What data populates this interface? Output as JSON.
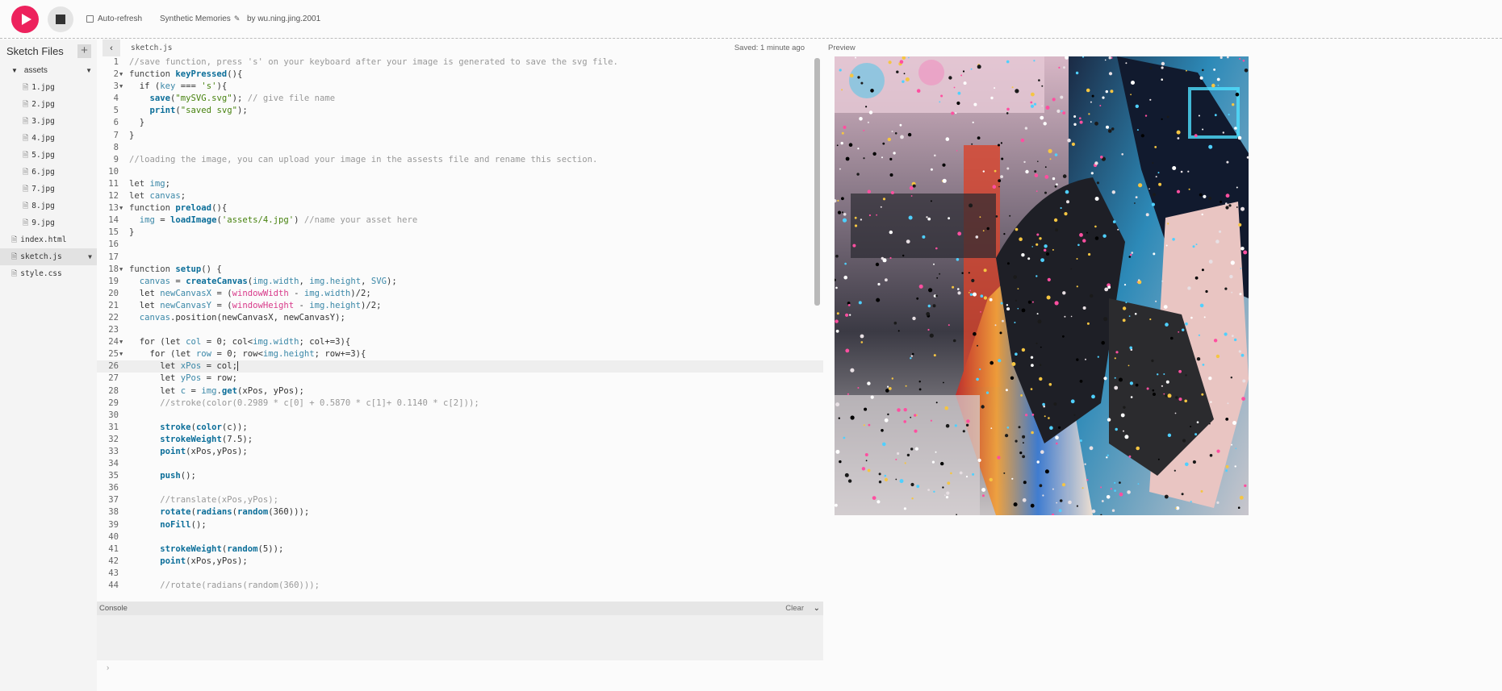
{
  "toolbar": {
    "autorefresh_label": "Auto-refresh",
    "project_name": "Synthetic Memories",
    "byline": "by wu.ning.jing.2001"
  },
  "sidebar": {
    "title": "Sketch Files",
    "folder": "assets",
    "asset_files": [
      "1.jpg",
      "2.jpg",
      "3.jpg",
      "4.jpg",
      "5.jpg",
      "6.jpg",
      "7.jpg",
      "8.jpg",
      "9.jpg"
    ],
    "root_files": [
      "index.html",
      "sketch.js",
      "style.css"
    ],
    "active_file": "sketch.js"
  },
  "editor": {
    "filename": "sketch.js",
    "saved_status": "Saved: 1 minute ago",
    "cursor_line": 26
  },
  "preview": {
    "label": "Preview"
  },
  "console": {
    "title": "Console",
    "clear_label": "Clear",
    "prompt": "›"
  },
  "code_lines": [
    [
      [
        "c",
        "//save function, press 's' on your keyboard after your image is generated to save the svg file."
      ]
    ],
    [
      [
        "k",
        "function "
      ],
      [
        "f",
        "keyPressed"
      ],
      [
        "n",
        "(){"
      ]
    ],
    [
      [
        "n",
        "  if ("
      ],
      [
        "v",
        "key"
      ],
      [
        "n",
        " === "
      ],
      [
        "s",
        "'s'"
      ],
      [
        "n",
        "){"
      ]
    ],
    [
      [
        "n",
        "    "
      ],
      [
        "f",
        "save"
      ],
      [
        "n",
        "("
      ],
      [
        "s",
        "\"mySVG.svg\""
      ],
      [
        "n",
        "); "
      ],
      [
        "c",
        "// give file name"
      ]
    ],
    [
      [
        "n",
        "    "
      ],
      [
        "f",
        "print"
      ],
      [
        "n",
        "("
      ],
      [
        "s",
        "\"saved svg\""
      ],
      [
        "n",
        ");"
      ]
    ],
    [
      [
        "n",
        "  }"
      ]
    ],
    [
      [
        "n",
        "}"
      ]
    ],
    [],
    [
      [
        "c",
        "//loading the image, you can upload your image in the assests file and rename this section."
      ]
    ],
    [],
    [
      [
        "k",
        "let "
      ],
      [
        "v",
        "img"
      ],
      [
        "n",
        ";"
      ]
    ],
    [
      [
        "k",
        "let "
      ],
      [
        "v",
        "canvas"
      ],
      [
        "n",
        ";"
      ]
    ],
    [
      [
        "k",
        "function "
      ],
      [
        "f",
        "preload"
      ],
      [
        "n",
        "(){"
      ]
    ],
    [
      [
        "n",
        "  "
      ],
      [
        "v",
        "img"
      ],
      [
        "n",
        " = "
      ],
      [
        "f",
        "loadImage"
      ],
      [
        "n",
        "("
      ],
      [
        "s",
        "'assets/4.jpg'"
      ],
      [
        "n",
        ") "
      ],
      [
        "c",
        "//name your asset here"
      ]
    ],
    [
      [
        "n",
        "}"
      ]
    ],
    [],
    [],
    [
      [
        "k",
        "function "
      ],
      [
        "f",
        "setup"
      ],
      [
        "n",
        "() {"
      ]
    ],
    [
      [
        "n",
        "  "
      ],
      [
        "v",
        "canvas"
      ],
      [
        "n",
        " = "
      ],
      [
        "f",
        "createCanvas"
      ],
      [
        "n",
        "("
      ],
      [
        "v",
        "img.width"
      ],
      [
        "n",
        ", "
      ],
      [
        "v",
        "img.height"
      ],
      [
        "n",
        ", "
      ],
      [
        "v",
        "SVG"
      ],
      [
        "n",
        ");"
      ]
    ],
    [
      [
        "n",
        "  let "
      ],
      [
        "v",
        "newCanvasX"
      ],
      [
        "n",
        " = ("
      ],
      [
        "m",
        "windowWidth"
      ],
      [
        "n",
        " - "
      ],
      [
        "v",
        "img.width"
      ],
      [
        "n",
        ")/2;"
      ]
    ],
    [
      [
        "n",
        "  let "
      ],
      [
        "v",
        "newCanvasY"
      ],
      [
        "n",
        " = ("
      ],
      [
        "m",
        "windowHeight"
      ],
      [
        "n",
        " - "
      ],
      [
        "v",
        "img.height"
      ],
      [
        "n",
        ")/2;"
      ]
    ],
    [
      [
        "n",
        "  "
      ],
      [
        "v",
        "canvas"
      ],
      [
        "n",
        ".position(newCanvasX, newCanvasY);"
      ]
    ],
    [],
    [
      [
        "n",
        "  for (let "
      ],
      [
        "v",
        "col"
      ],
      [
        "n",
        " = 0; col<"
      ],
      [
        "v",
        "img.width"
      ],
      [
        "n",
        "; col+=3){"
      ]
    ],
    [
      [
        "n",
        "    for (let "
      ],
      [
        "v",
        "row"
      ],
      [
        "n",
        " = 0; row<"
      ],
      [
        "v",
        "img.height"
      ],
      [
        "n",
        "; row+=3){"
      ]
    ],
    [
      [
        "n",
        "      let "
      ],
      [
        "v",
        "xPos"
      ],
      [
        "n",
        " = col;"
      ]
    ],
    [
      [
        "n",
        "      let "
      ],
      [
        "v",
        "yPos"
      ],
      [
        "n",
        " = row;"
      ]
    ],
    [
      [
        "n",
        "      let "
      ],
      [
        "v",
        "c"
      ],
      [
        "n",
        " = "
      ],
      [
        "v",
        "img"
      ],
      [
        "n",
        "."
      ],
      [
        "f",
        "get"
      ],
      [
        "n",
        "(xPos, yPos);"
      ]
    ],
    [
      [
        "c",
        "      //stroke(color(0.2989 * c[0] + 0.5870 * c[1]+ 0.1140 * c[2]));"
      ]
    ],
    [],
    [
      [
        "n",
        "      "
      ],
      [
        "f",
        "stroke"
      ],
      [
        "n",
        "("
      ],
      [
        "f",
        "color"
      ],
      [
        "n",
        "(c));"
      ]
    ],
    [
      [
        "n",
        "      "
      ],
      [
        "f",
        "strokeWeight"
      ],
      [
        "n",
        "(7.5);"
      ]
    ],
    [
      [
        "n",
        "      "
      ],
      [
        "f",
        "point"
      ],
      [
        "n",
        "(xPos,yPos);"
      ]
    ],
    [],
    [
      [
        "n",
        "      "
      ],
      [
        "f",
        "push"
      ],
      [
        "n",
        "();"
      ]
    ],
    [],
    [
      [
        "c",
        "      //translate(xPos,yPos);"
      ]
    ],
    [
      [
        "n",
        "      "
      ],
      [
        "f",
        "rotate"
      ],
      [
        "n",
        "("
      ],
      [
        "f",
        "radians"
      ],
      [
        "n",
        "("
      ],
      [
        "f",
        "random"
      ],
      [
        "n",
        "(360)));"
      ]
    ],
    [
      [
        "n",
        "      "
      ],
      [
        "f",
        "noFill"
      ],
      [
        "n",
        "();"
      ]
    ],
    [],
    [
      [
        "n",
        "      "
      ],
      [
        "f",
        "strokeWeight"
      ],
      [
        "n",
        "("
      ],
      [
        "f",
        "random"
      ],
      [
        "n",
        "(5));"
      ]
    ],
    [
      [
        "n",
        "      "
      ],
      [
        "f",
        "point"
      ],
      [
        "n",
        "(xPos,yPos);"
      ]
    ],
    [],
    [
      [
        "c",
        "      //rotate(radians(random(360)));"
      ]
    ]
  ],
  "fold_lines": [
    2,
    3,
    13,
    18,
    24,
    25
  ]
}
